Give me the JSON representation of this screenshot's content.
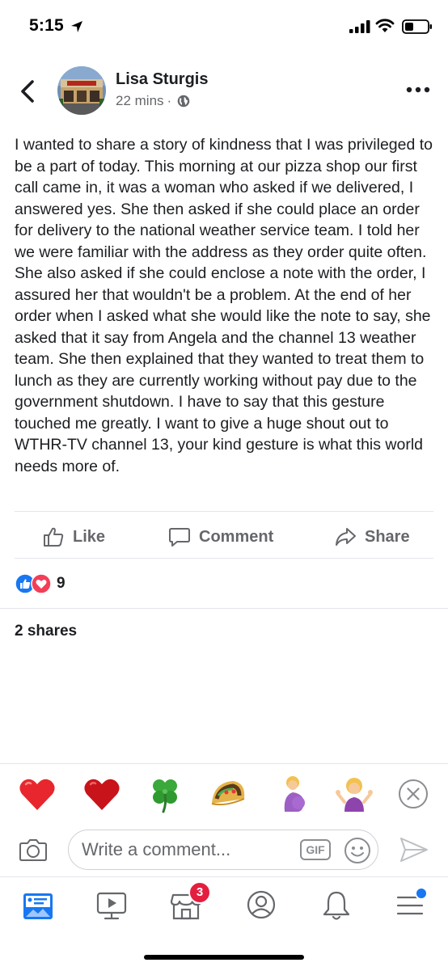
{
  "status_bar": {
    "time": "5:15",
    "icons": [
      "location-arrow-icon",
      "signal-icon",
      "wifi-icon",
      "battery-icon"
    ]
  },
  "post": {
    "author": "Lisa Sturgis",
    "time": "22 mins",
    "separator": "·",
    "privacy_icon": "globe-icon",
    "text": "I wanted to share a story of kindness that I was privileged to be a part of today. This morning at our pizza shop our first call came in, it was a woman who asked if we delivered, I answered yes. She then asked if she could place an order for delivery to the national weather service team. I told her we were familiar with the address as they order quite often. She also asked if she could enclose a note with the order, I assured her that wouldn't be a problem. At the end of her order when I asked what she would like the note to say, she asked that it say from Angela and the channel 13 weather team. She then explained that they wanted to treat them to lunch as they are currently working without pay due to the government shutdown. I have to say that this gesture touched me greatly. I want to give a huge shout out to WTHR-TV channel 13, your kind gesture is what this world needs more of."
  },
  "actions": {
    "like": "Like",
    "comment": "Comment",
    "share": "Share"
  },
  "reactions": {
    "types": [
      "like-reaction-icon",
      "love-reaction-icon"
    ],
    "count": "9"
  },
  "shares_text": "2 shares",
  "emoji_bar": {
    "emojis": [
      "red-heart",
      "heavy-heart",
      "four-leaf-clover",
      "taco",
      "pregnant-woman",
      "person-shrugging"
    ]
  },
  "comment_bar": {
    "placeholder": "Write a comment...",
    "gif_label": "GIF"
  },
  "bottom_nav": {
    "items": [
      "news-feed-icon",
      "watch-icon",
      "marketplace-icon",
      "profile-icon",
      "notifications-icon",
      "menu-icon"
    ],
    "marketplace_badge": "3"
  },
  "colors": {
    "primary_text": "#1c1e21",
    "secondary_text": "#65676b",
    "facebook_blue": "#1877f2",
    "badge_red": "#e41e3f",
    "divider": "#e4e6eb"
  }
}
